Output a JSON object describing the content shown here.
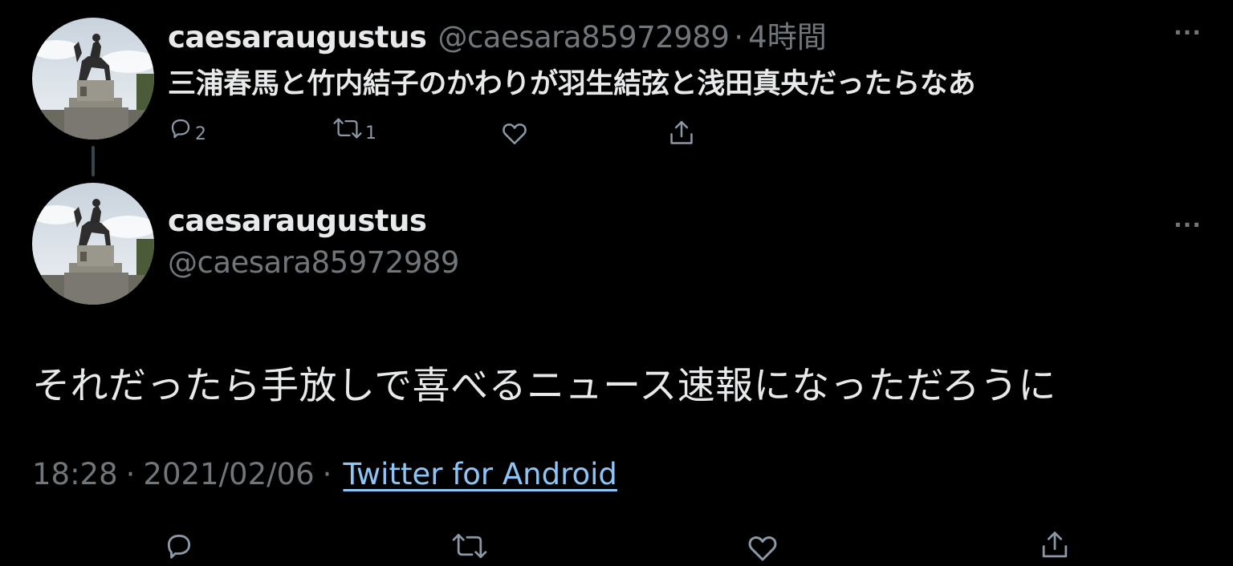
{
  "parent_tweet": {
    "display_name": "caesaraugustus",
    "handle": "@caesara85972989",
    "separator": "·",
    "time": "4時間",
    "text": "三浦春馬と竹内結子のかわりが羽生結弦と浅田真央だったらなあ",
    "more_label": "···",
    "actions": {
      "reply_count": "2",
      "retweet_count": "1"
    }
  },
  "main_tweet": {
    "display_name": "caesaraugustus",
    "handle": "@caesara85972989",
    "more_label": "···",
    "text": "それだったら手放しで喜べるニュース速報になっただろうに",
    "time": "18:28",
    "date": "2021/02/06",
    "separator": "·",
    "source": "Twitter for Android"
  },
  "colors": {
    "background": "#000000",
    "primary_text": "#e7e9ea",
    "secondary_text": "#71767b",
    "link": "#8ec5f7",
    "icon": "#8b98a5"
  },
  "icons": [
    "reply-icon",
    "retweet-icon",
    "like-icon",
    "share-icon",
    "more-icon"
  ]
}
